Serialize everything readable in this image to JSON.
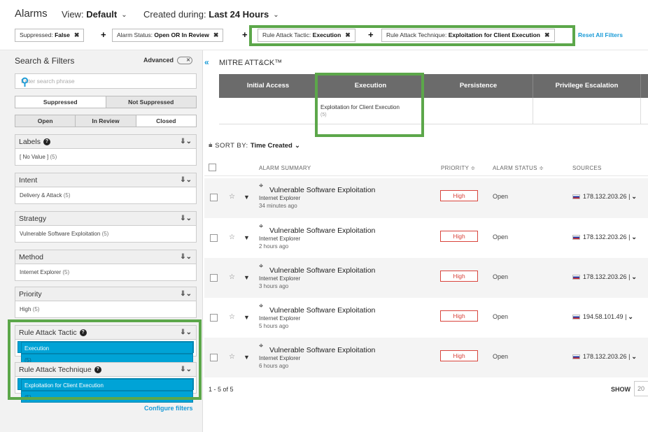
{
  "header": {
    "title": "Alarms",
    "view_label": "View:",
    "view_value": "Default",
    "created_label": "Created during:",
    "created_value": "Last 24 Hours",
    "chevron": "⌄"
  },
  "chips": [
    {
      "label": "Suppressed:",
      "value": "False",
      "remove": "✖"
    },
    {
      "label": "Alarm Status:",
      "value": "Open OR In Review",
      "remove": "✖"
    },
    {
      "label": "Rule Attack Tactic:",
      "value": "Execution",
      "remove": "✖"
    },
    {
      "label": "Rule Attack Technique:",
      "value": "Exploitation for Client Execution",
      "remove": "✖"
    }
  ],
  "plus": "+",
  "reset_all": "Reset All Filters",
  "sidebar": {
    "title": "Search & Filters",
    "advanced_label": "Advanced",
    "toggle_text": "✕",
    "search_placeholder": "Enter search phrase",
    "search_icon": "⚲",
    "suppressed_options": [
      "Suppressed",
      "Not Suppressed"
    ],
    "status_options": [
      "Open",
      "In Review",
      "Closed"
    ],
    "filters": [
      {
        "title": "Labels",
        "help": true,
        "value": "[ No Value ]",
        "count": "(5)",
        "selected": false
      },
      {
        "title": "Intent",
        "help": false,
        "value": "Delivery & Attack",
        "count": "(5)",
        "selected": false
      },
      {
        "title": "Strategy",
        "help": false,
        "value": "Vulnerable Software Exploitation",
        "count": "(5)",
        "selected": false
      },
      {
        "title": "Method",
        "help": false,
        "value": "Internet Explorer",
        "count": "(5)",
        "selected": false
      },
      {
        "title": "Priority",
        "help": false,
        "value": "High",
        "count": "(5)",
        "selected": false
      },
      {
        "title": "Rule Attack Tactic",
        "help": true,
        "value": "Execution",
        "count": "(5)",
        "selected": true
      },
      {
        "title": "Rule Attack Technique",
        "help": true,
        "value": "Exploitation for Client Execution",
        "count": "(5)",
        "selected": true
      }
    ],
    "sort_icon": "⇓⌄",
    "help_icon": "?",
    "configure": "Configure filters"
  },
  "mitre": {
    "collapse_icon": "«",
    "title": "MITRE ATT&CK™",
    "columns": [
      "Initial Access",
      "Execution",
      "Persistence",
      "Privilege Escalation"
    ],
    "cell_text": "Exploitation for Client Execution",
    "cell_count": "(5)"
  },
  "sort": {
    "icon": "⩧",
    "label": "SORT BY:",
    "value": "Time Created",
    "chevron": "⌄"
  },
  "table": {
    "headers": {
      "summary": "ALARM SUMMARY",
      "priority": "PRIORITY ≑",
      "status": "ALARM STATUS ≑",
      "sources": "SOURCES"
    },
    "rows": [
      {
        "title": "Vulnerable Software Exploitation",
        "sub": "Internet Explorer",
        "time": "34 minutes ago",
        "priority": "High",
        "status": "Open",
        "source": "178.132.203.26"
      },
      {
        "title": "Vulnerable Software Exploitation",
        "sub": "Internet Explorer",
        "time": "2 hours ago",
        "priority": "High",
        "status": "Open",
        "source": "178.132.203.26"
      },
      {
        "title": "Vulnerable Software Exploitation",
        "sub": "Internet Explorer",
        "time": "3 hours ago",
        "priority": "High",
        "status": "Open",
        "source": "178.132.203.26"
      },
      {
        "title": "Vulnerable Software Exploitation",
        "sub": "Internet Explorer",
        "time": "5 hours ago",
        "priority": "High",
        "status": "Open",
        "source": "194.58.101.49"
      },
      {
        "title": "Vulnerable Software Exploitation",
        "sub": "Internet Explorer",
        "time": "6 hours ago",
        "priority": "High",
        "status": "Open",
        "source": "178.132.203.26"
      }
    ],
    "star_icon": "☆",
    "funnel_icon": "▼",
    "target_icon": "⌖",
    "source_dropdown": "⌄"
  },
  "pager": {
    "range": "1 - 5 of 5",
    "show_label": "SHOW",
    "show_value": "20"
  },
  "colors": {
    "accent": "#1a9bd7",
    "highlight": "#5ca74a",
    "selected": "#00a3d6",
    "high": "#d9443c"
  }
}
